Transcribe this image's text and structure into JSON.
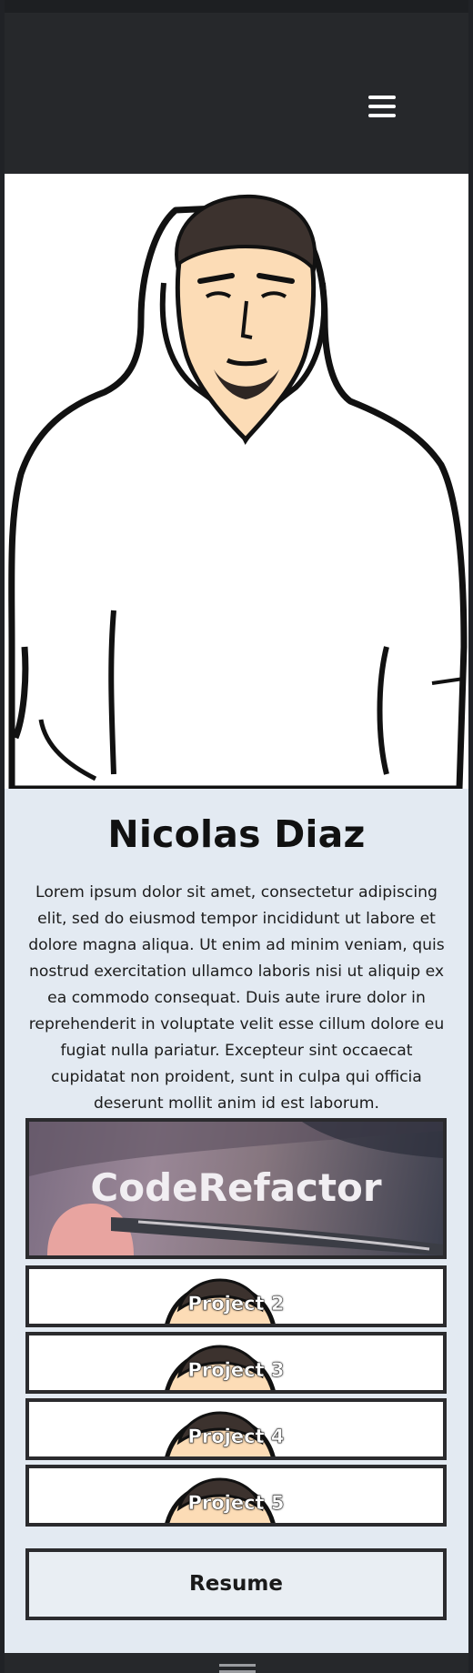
{
  "navbar": {
    "menu_icon": "hamburger-menu-icon"
  },
  "profile": {
    "name": "Nicolas Diaz",
    "bio": "Lorem ipsum dolor sit amet, consectetur adipiscing elit, sed do eiusmod tempor incididunt ut labore et dolore magna aliqua. Ut enim ad minim veniam, quis nostrud exercitation ullamco laboris nisi ut aliquip ex ea commodo consequat. Duis aute irure dolor in reprehenderit in voluptate velit esse cillum dolore eu fugiat nulla pariatur. Excepteur sint occaecat cupidatat non proident, sunt in culpa qui officia deserunt mollit anim id est laborum."
  },
  "projects": [
    {
      "label": "CodeRefactor"
    },
    {
      "label": "Project 2"
    },
    {
      "label": "Project 3"
    },
    {
      "label": "Project 4"
    },
    {
      "label": "Project 5"
    }
  ],
  "resume": {
    "label": "Resume"
  },
  "colors": {
    "navbar": "#26282b",
    "content_bg": "#e3eaf2",
    "card_border": "#2b2b2e",
    "skin": "#fcdcb6"
  }
}
